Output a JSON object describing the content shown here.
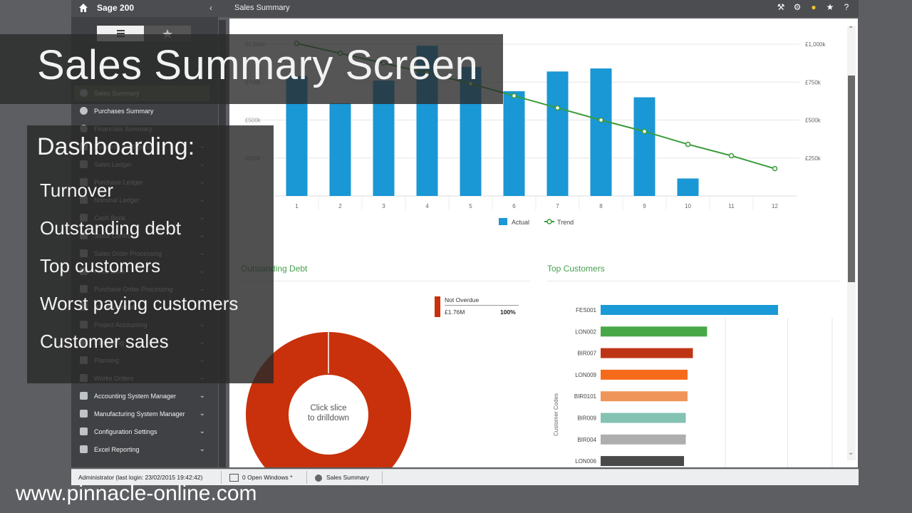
{
  "app": {
    "title": "Sage 200",
    "screen_title": "Sales Summary"
  },
  "top_icons": [
    "tools-icon",
    "gear-icon",
    "lightbulb-icon",
    "star-icon",
    "help-icon"
  ],
  "sidebar": {
    "items": [
      {
        "label": "Sales Summary",
        "icon": "globe-icon",
        "active": true,
        "chevron": false
      },
      {
        "label": "Purchases Summary",
        "icon": "globe-icon",
        "active": false,
        "chevron": false
      },
      {
        "label": "Financials Summary",
        "icon": "globe-icon",
        "active": false,
        "chevron": false
      },
      {
        "label": "Business Intelligence",
        "icon": "chart-icon",
        "active": false,
        "chevron": true
      },
      {
        "label": "Sales Ledger",
        "icon": "ledger-icon",
        "active": false,
        "chevron": true
      },
      {
        "label": "Purchase Ledger",
        "icon": "ledger-icon",
        "active": false,
        "chevron": true
      },
      {
        "label": "Nominal Ledger",
        "icon": "ledger-icon",
        "active": false,
        "chevron": true
      },
      {
        "label": "Cash Book",
        "icon": "book-icon",
        "active": false,
        "chevron": true
      },
      {
        "label": "Stock Control",
        "icon": "box-icon",
        "active": false,
        "chevron": true
      },
      {
        "label": "Sales Order Processing",
        "icon": "order-icon",
        "active": false,
        "chevron": true
      },
      {
        "label": "Price Book",
        "icon": "book-icon",
        "active": false,
        "chevron": true
      },
      {
        "label": "Purchase Order Processing",
        "icon": "order-icon",
        "active": false,
        "chevron": true
      },
      {
        "label": "Bill of Materials",
        "icon": "bom-icon",
        "active": false,
        "chevron": true
      },
      {
        "label": "Project Accounting",
        "icon": "project-icon",
        "active": false,
        "chevron": true
      },
      {
        "label": "Estimating",
        "icon": "estimate-icon",
        "active": false,
        "chevron": true
      },
      {
        "label": "Planning",
        "icon": "planning-icon",
        "active": false,
        "chevron": true
      },
      {
        "label": "Works Orders",
        "icon": "works-icon",
        "active": false,
        "chevron": true
      },
      {
        "label": "Accounting System Manager",
        "icon": "manager-icon",
        "active": false,
        "chevron": true
      },
      {
        "label": "Manufacturing System Manager",
        "icon": "manager-icon",
        "active": false,
        "chevron": true
      },
      {
        "label": "Configuration Settings",
        "icon": "config-icon",
        "active": false,
        "chevron": true
      },
      {
        "label": "Excel Reporting",
        "icon": "excel-icon",
        "active": false,
        "chevron": true
      }
    ]
  },
  "sections": {
    "outstanding_debt": "Outstanding Debt",
    "top_customers": "Top Customers"
  },
  "donut": {
    "center_line1": "Click slice",
    "center_line2": "to drilldown",
    "color": "#c8310b",
    "legend": {
      "label": "Not Overdue",
      "value": "£1.76M",
      "percent": "100%"
    }
  },
  "chart_data": [
    {
      "type": "bar",
      "title": "",
      "categories": [
        "1",
        "2",
        "3",
        "4",
        "5",
        "6",
        "7",
        "8",
        "9",
        "10",
        "11",
        "12"
      ],
      "series": [
        {
          "name": "Actual",
          "type": "bar",
          "color": "#1a97d5",
          "values": [
            790,
            610,
            760,
            990,
            850,
            690,
            820,
            840,
            650,
            115,
            null,
            null
          ]
        },
        {
          "name": "Trend",
          "type": "line",
          "color": "#3a9c3a",
          "values": [
            1005,
            940,
            875,
            810,
            740,
            660,
            580,
            500,
            425,
            340,
            265,
            180
          ]
        }
      ],
      "y_ticks": [
        "£250k",
        "£500k",
        "£750k",
        "£1,000k"
      ],
      "ylim": [
        0,
        1000
      ],
      "legend": [
        "Actual",
        "Trend"
      ],
      "legend_position": "bottom"
    },
    {
      "type": "bar",
      "orientation": "horizontal",
      "title": "Top Customers",
      "ylabel": "Customer Codes",
      "categories": [
        "FES001",
        "LON002",
        "BIR007",
        "LON009",
        "BIR0101",
        "BIR009",
        "BIR004",
        "LON006"
      ],
      "values": [
        100,
        60,
        52,
        49,
        49,
        48,
        48,
        47
      ],
      "colors": [
        "#1a9ad6",
        "#48a847",
        "#be3515",
        "#f56b1b",
        "#f0955a",
        "#84c2b2",
        "#aeaeae",
        "#494949"
      ]
    }
  ],
  "statusbar": {
    "user": "Administrator (last login: 23/02/2015 19:42:42)",
    "windows": "0 Open Windows *",
    "current": "Sales Summary"
  },
  "overlay": {
    "banner": "Sales Summary Screen",
    "heading": "Dashboarding:",
    "items": [
      "Turnover",
      "Outstanding debt",
      "Top customers",
      "Worst paying customers",
      "Customer sales"
    ],
    "url": "www.pinnacle-online.com"
  }
}
